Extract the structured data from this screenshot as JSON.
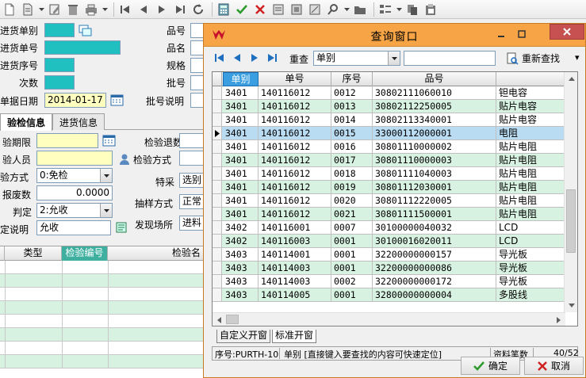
{
  "bg_form": {
    "labels": {
      "left": [
        "进货单别",
        "进货单号",
        "进货序号",
        "次数",
        "单据日期"
      ],
      "right": [
        "品号",
        "品名",
        "规格",
        "批号",
        "批号说明"
      ],
      "inspect_left": [
        "验期限",
        "验人员",
        "验方式",
        "报废数",
        "判定",
        "定说明"
      ],
      "inspect_right": [
        "检验退数",
        "检验方式",
        "特采",
        "抽样方式",
        "发现场所"
      ]
    },
    "date_value": "2014-01-17",
    "method_value": "0:免检",
    "scrap_value": "0.0000",
    "judge_value": "2:允收",
    "judge_desc_value": "允收",
    "special_value": "选别",
    "sample_value": "正常",
    "found_value": "进料",
    "tabs": [
      "验检信息",
      "进货信息"
    ],
    "grid_headers": [
      "类型",
      "检验编号",
      "检验名"
    ]
  },
  "window": {
    "title": "查询窗口",
    "nav": {
      "requery_label": "重查",
      "field_select": "单别",
      "search_value": "",
      "refind_label": "重新查找"
    },
    "grid": {
      "columns": [
        "单别",
        "单号",
        "序号",
        "品号",
        ""
      ],
      "rows": [
        [
          "3401",
          "140116012",
          "0012",
          "30802111060010",
          "钽电容"
        ],
        [
          "3401",
          "140116012",
          "0013",
          "30802112250005",
          "贴片电容"
        ],
        [
          "3401",
          "140116012",
          "0014",
          "30802113340001",
          "贴片电容"
        ],
        [
          "3401",
          "140116012",
          "0015",
          "33000112000001",
          "电阻"
        ],
        [
          "3401",
          "140116012",
          "0016",
          "30801110000002",
          "贴片电阻"
        ],
        [
          "3401",
          "140116012",
          "0017",
          "30801110000003",
          "贴片电阻"
        ],
        [
          "3401",
          "140116012",
          "0018",
          "30801111040003",
          "贴片电阻"
        ],
        [
          "3401",
          "140116012",
          "0019",
          "30801112030001",
          "贴片电阻"
        ],
        [
          "3401",
          "140116012",
          "0020",
          "30801112220005",
          "贴片电阻"
        ],
        [
          "3401",
          "140116012",
          "0021",
          "30801111500001",
          "贴片电阻"
        ],
        [
          "3402",
          "140116001",
          "0007",
          "30100000040032",
          "LCD"
        ],
        [
          "3402",
          "140116003",
          "0001",
          "30100016020011",
          "LCD"
        ],
        [
          "3403",
          "140114001",
          "0001",
          "32200000000157",
          "导光板"
        ],
        [
          "3403",
          "140114003",
          "0001",
          "32200000000086",
          "导光板"
        ],
        [
          "3403",
          "140114003",
          "0002",
          "32200000000172",
          "导光板"
        ],
        [
          "3403",
          "140114005",
          "0001",
          "32800000000004",
          "多股线"
        ]
      ],
      "current_row": 3
    },
    "tabs": [
      "自定义开窗",
      "标准开窗"
    ],
    "status": {
      "seq": "序号:PURTH-10",
      "hint": "单别 [直接键入要查找的内容可快速定位]",
      "count_label": "资料笔数",
      "count_value": "40/52"
    },
    "buttons": {
      "ok": "确定",
      "cancel": "取消"
    }
  },
  "colors": {
    "title_bar": "#f6a445",
    "grid_alt_row": "#d8f2e2",
    "selected_header": "#3a9ee0",
    "teal_field": "#20c0c0",
    "yellow_field": "#ffffc0"
  }
}
